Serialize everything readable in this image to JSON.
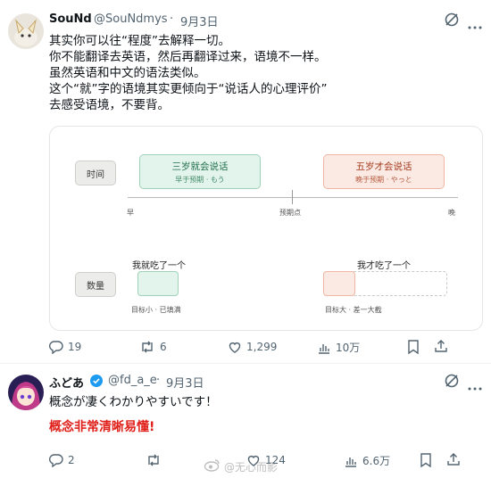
{
  "post1": {
    "name": "SouNd",
    "handle": "@SouNdmys",
    "dot": "·",
    "date": "9月3日",
    "lines": [
      "其实你可以往“程度”去解释一切。",
      "你不能翻译去英语，然后再翻译过来，语境不一样。",
      "虽然英语和中文的语法类似。",
      "这个“就”字的语境其实更倾向于“说话人的心理评价”",
      "去感受语境，不要背。"
    ],
    "card": {
      "time_label": "时间",
      "early_title": "三岁就会说话",
      "early_sub": "早于预期 · もう",
      "late_title": "五岁才会说话",
      "late_sub": "晚于预期 · やっと",
      "axis_left": "早",
      "axis_mid": "预期点",
      "axis_right": "晚",
      "qty_label": "数量",
      "ate_little": "我就吃了一个",
      "ate_little_note": "目标小 · 已填满",
      "ate_only": "我才吃了一个",
      "ate_only_note": "目标大 · 差一大截"
    },
    "stats": {
      "replies": "19",
      "reposts": "6",
      "likes": "1,299",
      "views": "10万"
    }
  },
  "post2": {
    "name": "ふどあ",
    "handle": "@fd_a_e",
    "dot": "·",
    "date": "9月3日",
    "text": "概念が凄くわかりやすいです！",
    "translation": "概念非常清晰易懂!",
    "stats": {
      "replies": "2",
      "reposts": "",
      "likes": "124",
      "views": "6.6万"
    }
  },
  "watermark": "@无心而影",
  "colors": {
    "verified": "#1d9bf0",
    "translation": "#e0201a",
    "early_fill": "#e3f4ec",
    "late_fill": "#fbe9e3"
  }
}
